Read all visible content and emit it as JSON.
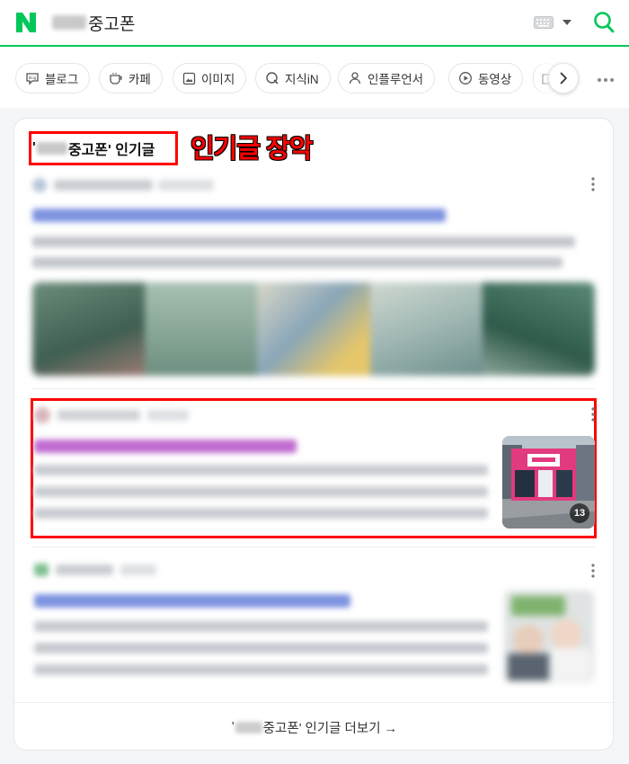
{
  "header": {
    "query_text": "중고폰",
    "logo_icon": "naver-n-logo",
    "keyboard_icon": "keyboard-icon",
    "search_icon": "search-icon",
    "brand_color": "#03c75a"
  },
  "tabs": [
    {
      "label": "블로그",
      "icon": "blog-icon"
    },
    {
      "label": "카페",
      "icon": "cafe-icon"
    },
    {
      "label": "이미지",
      "icon": "image-icon"
    },
    {
      "label": "지식iN",
      "icon": "kin-icon"
    },
    {
      "label": "인플루언서",
      "icon": "person-icon"
    },
    {
      "label": "동영상",
      "icon": "play-icon"
    }
  ],
  "section": {
    "title_prefix": "'",
    "title_main": "중고폰' 인기글",
    "annotation": "인기글 장악",
    "annotation_color": "#ff0000"
  },
  "posts": [
    {
      "thumb_badge": ""
    },
    {
      "thumb_badge": "13"
    },
    {
      "thumb_badge": ""
    }
  ],
  "footer": {
    "prefix": "'",
    "text": "중고폰' 인기글 더보기 →"
  }
}
